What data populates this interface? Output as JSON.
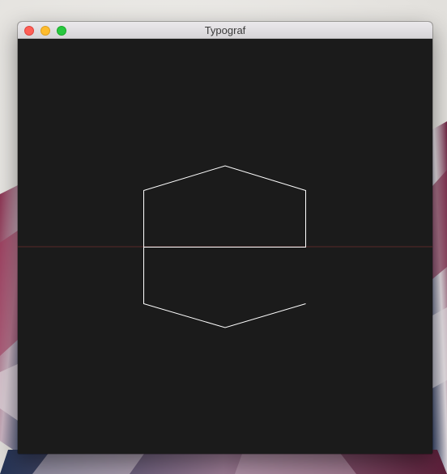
{
  "window": {
    "title": "Typograf"
  },
  "canvas": {
    "background": "#1b1b1b",
    "stroke_color": "#ffffff",
    "baseline_color": "#5a2a28"
  },
  "colors": {
    "close": "#fe5f57",
    "minimize": "#febc2e",
    "zoom": "#28c840"
  }
}
